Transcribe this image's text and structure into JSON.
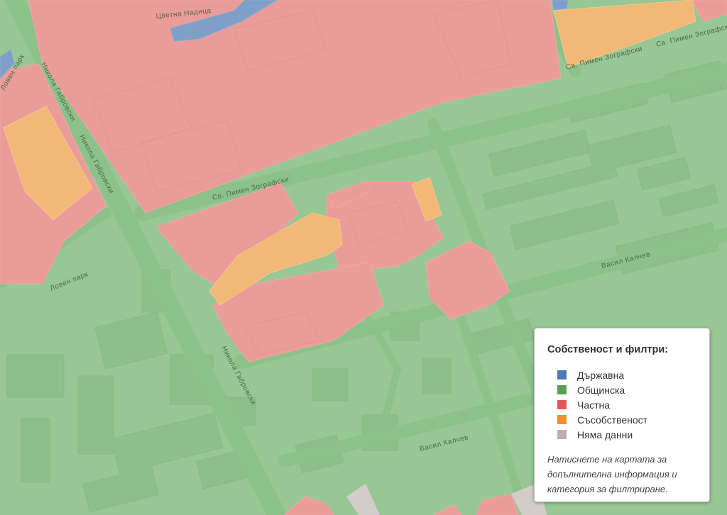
{
  "map": {
    "streets": {
      "nikola_gabrovski_top": "Никола Габровски",
      "nikola_gabrovski_mid": "Никола Габровски",
      "nikola_gabrovski_bottom": "Никола Габровски",
      "pimen_zografski_center": "Св. Пимен Зографски",
      "pimen_zografski_right": "Св. Пимен Зографски",
      "pimen_zografski_far": "Св. Пимен Зографски",
      "vasil_kalchev_mid": "Васил Калчев",
      "vasil_kalchev_bottom": "Васил Калчев",
      "loven_park": "Ловен парк",
      "loven_park_top": "Ловен парк",
      "top_partial": "Цветна Надица"
    }
  },
  "legend": {
    "title": "Собственост и филтри:",
    "items": [
      {
        "label": "Държавна",
        "color": "#4e79b5"
      },
      {
        "label": "Общинска",
        "color": "#59a14f"
      },
      {
        "label": "Частна",
        "color": "#e15759"
      },
      {
        "label": "Съсобственост",
        "color": "#f28e2b"
      },
      {
        "label": "Няма данни",
        "color": "#bab0ac"
      }
    ],
    "note": "Натиснете на картата за допълнителна информация и категория за филтриране."
  },
  "colors": {
    "municipal_fill": "#97c794",
    "private_fill": "#ea9c9a",
    "coowned_fill": "#f2b877",
    "state_fill": "#7ea0c8",
    "nodata_fill": "#d2cdcb",
    "road_fill": "#8cc189"
  }
}
